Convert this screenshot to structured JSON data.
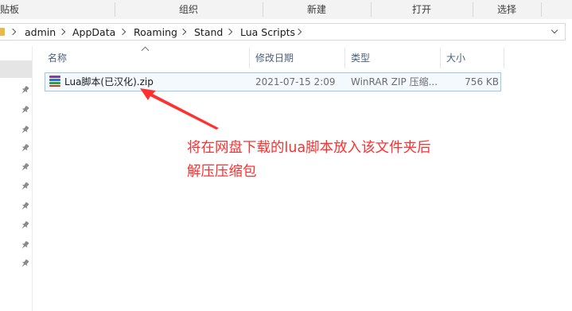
{
  "ribbon": {
    "groups": [
      "剪贴板",
      "组织",
      "新建",
      "打开",
      "选择"
    ]
  },
  "address": {
    "crumbs": [
      "admin",
      "AppData",
      "Roaming",
      "Stand",
      "Lua Scripts"
    ]
  },
  "columns": {
    "name": "名称",
    "modified": "修改日期",
    "type": "类型",
    "size": "大小"
  },
  "files": [
    {
      "name": "Lua脚本(已汉化).zip",
      "modified": "2021-07-15 2:09",
      "type": "WinRAR ZIP 压缩...",
      "size": "756 KB",
      "icon": "winrar-archive-icon"
    }
  ],
  "annotation": {
    "line1": "将在网盘下载的lua脚本放入该文件夹后",
    "line2": "解压压缩包",
    "color": "#ff3030"
  }
}
